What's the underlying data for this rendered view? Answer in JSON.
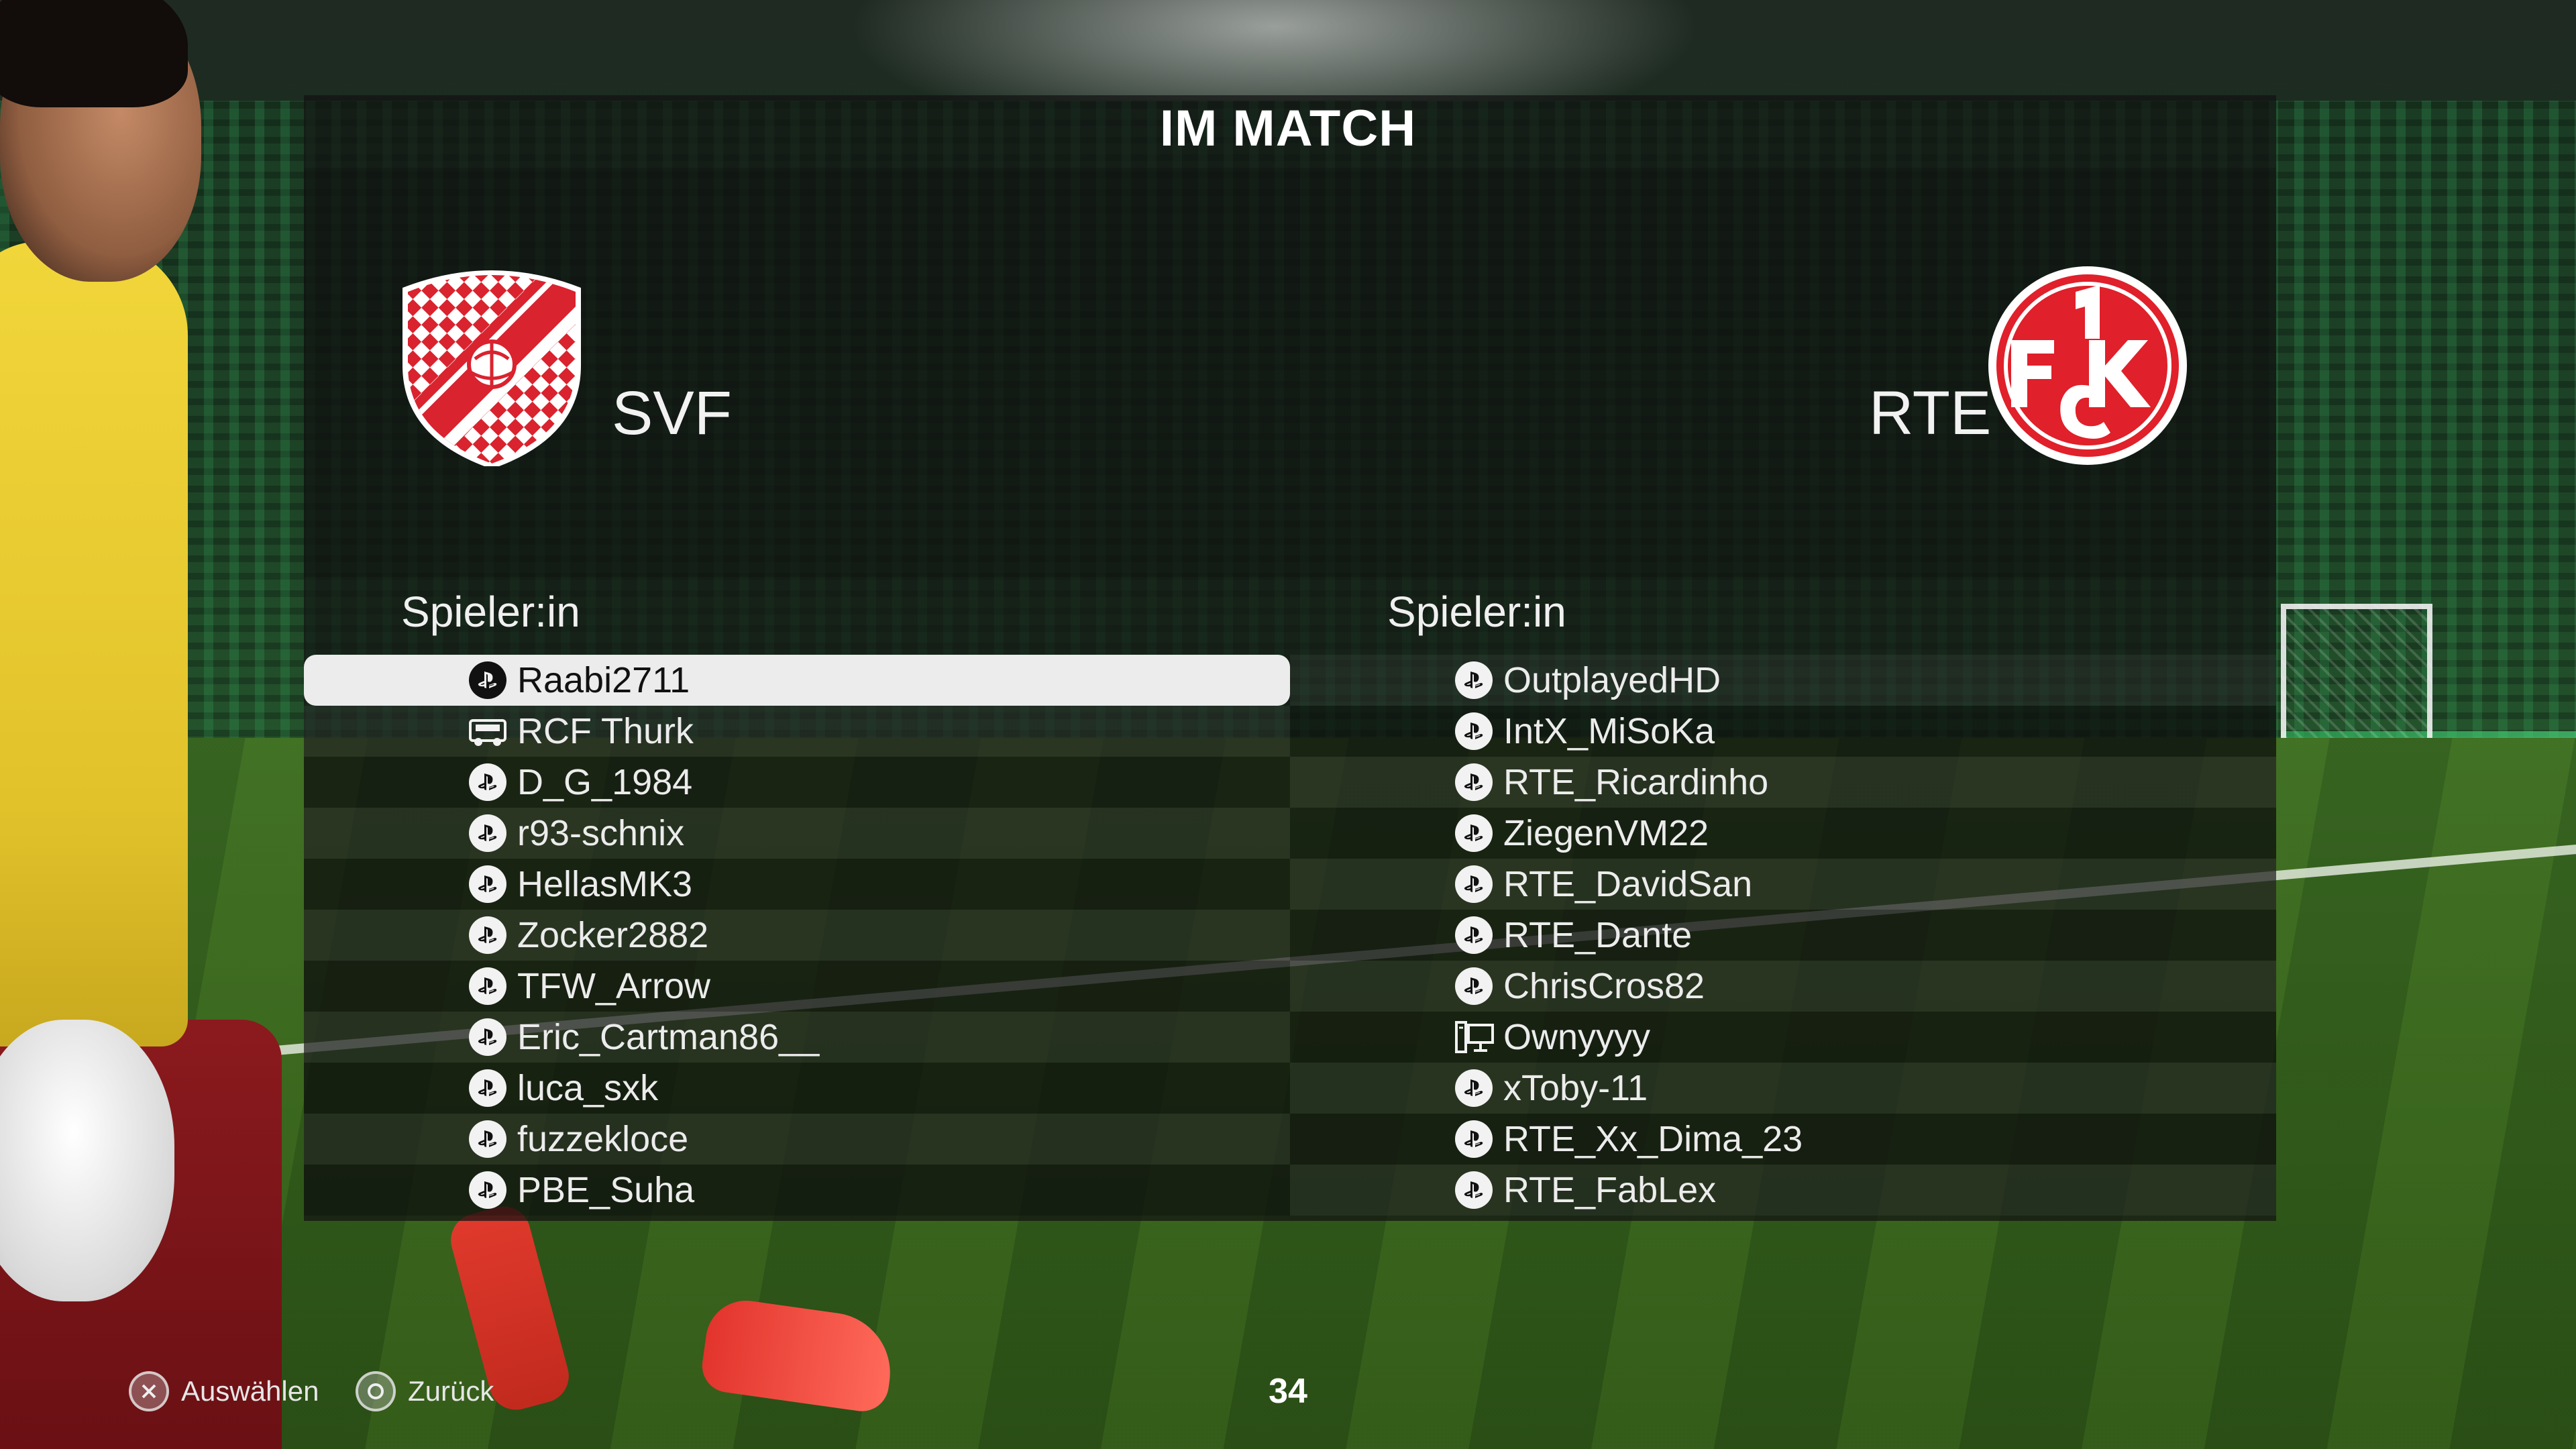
{
  "screen": {
    "title": "IM MATCH",
    "timer": "34"
  },
  "home_team": {
    "abbr": "SVF",
    "crest_icon": "svf-crest-icon",
    "column_header": "Spieler:in",
    "players": [
      {
        "name": "Raabi2711",
        "platform": "playstation",
        "selected": true
      },
      {
        "name": "RCF Thurk",
        "platform": "cpu-controller",
        "selected": false
      },
      {
        "name": "D_G_1984",
        "platform": "playstation",
        "selected": false
      },
      {
        "name": "r93-schnix",
        "platform": "playstation",
        "selected": false
      },
      {
        "name": "HellasMK3",
        "platform": "playstation",
        "selected": false
      },
      {
        "name": "Zocker2882",
        "platform": "playstation",
        "selected": false
      },
      {
        "name": "TFW_Arrow",
        "platform": "playstation",
        "selected": false
      },
      {
        "name": "Eric_Cartman86__",
        "platform": "playstation",
        "selected": false
      },
      {
        "name": "luca_sxk",
        "platform": "playstation",
        "selected": false
      },
      {
        "name": "fuzzekloce",
        "platform": "playstation",
        "selected": false
      },
      {
        "name": "PBE_Suha",
        "platform": "playstation",
        "selected": false
      }
    ]
  },
  "away_team": {
    "abbr": "RTE",
    "crest_icon": "fck-crest-icon",
    "column_header": "Spieler:in",
    "players": [
      {
        "name": "OutplayedHD",
        "platform": "playstation",
        "selected": false
      },
      {
        "name": "IntX_MiSoKa",
        "platform": "playstation",
        "selected": false
      },
      {
        "name": "RTE_Ricardinho",
        "platform": "playstation",
        "selected": false
      },
      {
        "name": "ZiegenVM22",
        "platform": "playstation",
        "selected": false
      },
      {
        "name": "RTE_DavidSan",
        "platform": "playstation",
        "selected": false
      },
      {
        "name": "RTE_Dante",
        "platform": "playstation",
        "selected": false
      },
      {
        "name": "ChrisCros82",
        "platform": "playstation",
        "selected": false
      },
      {
        "name": "Ownyyyy",
        "platform": "pc",
        "selected": false
      },
      {
        "name": "xToby-11",
        "platform": "playstation",
        "selected": false
      },
      {
        "name": "RTE_Xx_Dima_23",
        "platform": "playstation",
        "selected": false
      },
      {
        "name": "RTE_FabLex",
        "platform": "playstation",
        "selected": false
      }
    ]
  },
  "footer": {
    "select_label": "Auswählen",
    "select_icon": "cross-button-icon",
    "back_label": "Zurück",
    "back_icon": "circle-button-icon"
  },
  "colors": {
    "panel_bg": "#121212",
    "selected_row": "#ececec",
    "home_crest_red": "#d9232e",
    "away_crest_red": "#e0202a"
  }
}
